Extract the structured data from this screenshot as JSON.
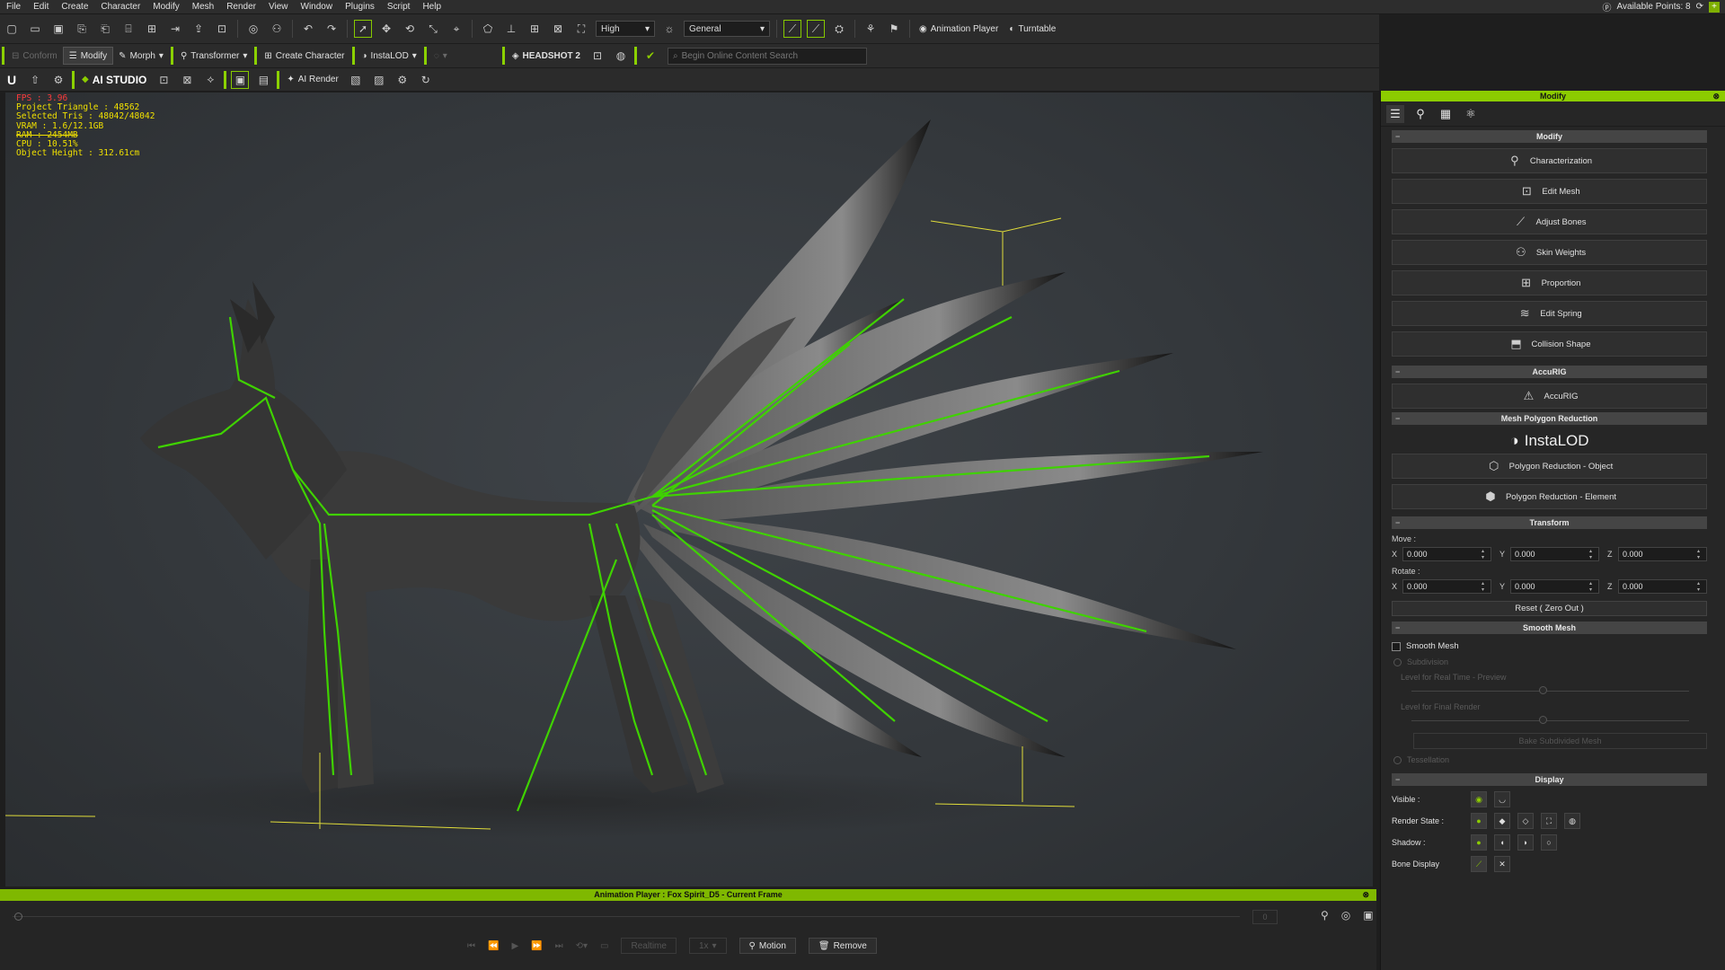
{
  "menu": [
    "File",
    "Edit",
    "Create",
    "Character",
    "Modify",
    "Mesh",
    "Render",
    "View",
    "Window",
    "Plugins",
    "Script",
    "Help"
  ],
  "menu_right": {
    "points": "Available Points: 8"
  },
  "toolbar1": {
    "quality": "High",
    "mode": "General",
    "animation_player": "Animation Player",
    "turntable": "Turntable"
  },
  "toolbar2": {
    "conform": "Conform",
    "modify": "Modify",
    "morph": "Morph",
    "transformer": "Transformer",
    "create_character": "Create Character",
    "instalod": "InstaLOD",
    "headshot": "HEADSHOT 2",
    "search_placeholder": "Begin Online Content Search"
  },
  "toolbar3": {
    "ai_studio": "AI STUDIO",
    "ai_render": "AI Render"
  },
  "stats": {
    "fps": "FPS : 3.96",
    "project_triangle": "Project Triangle : 48562",
    "selected_tris": "Selected Tris : 48042/48042",
    "vram": "VRAM : 1.6/12.1GB",
    "ram": "RAM : 2454MB",
    "cpu": "CPU : 10.51%",
    "object_height": "Object Height : 312.61cm"
  },
  "panel": {
    "title": "Modify",
    "modify_header": "Modify",
    "buttons": [
      "Characterization",
      "Edit Mesh",
      "Adjust Bones",
      "Skin Weights",
      "Proportion",
      "Edit Spring",
      "Collision Shape"
    ],
    "accurig_header": "AccuRIG",
    "accurig_btn": "AccuRIG",
    "mpr_header": "Mesh Polygon Reduction",
    "instalod_logo": "InstaLOD",
    "poly_object": "Polygon Reduction - Object",
    "poly_element": "Polygon Reduction - Element",
    "transform_header": "Transform",
    "move_label": "Move :",
    "rotate_label": "Rotate :",
    "axis_x": "X",
    "axis_y": "Y",
    "axis_z": "Z",
    "move": {
      "x": "0.000",
      "y": "0.000",
      "z": "0.000"
    },
    "rotate": {
      "x": "0.000",
      "y": "0.000",
      "z": "0.000"
    },
    "reset": "Reset ( Zero Out )",
    "smooth_header": "Smooth Mesh",
    "smooth_mesh": "Smooth Mesh",
    "subdivision": "Subdivision",
    "level_realtime": "Level for Real Time - Preview",
    "level_final": "Level for Final Render",
    "level_realtime_val": "1",
    "level_final_val": "1",
    "bake": "Bake Subdivided Mesh",
    "tessellation": "Tessellation",
    "display_header": "Display",
    "visible": "Visible :",
    "render_state": "Render State :",
    "shadow": "Shadow :",
    "bone_display": "Bone Display"
  },
  "anim": {
    "title": "Animation Player : Fox Spirit_D5 - Current Frame",
    "frame": "0",
    "realtime": "Realtime",
    "speed": "1x",
    "motion": "Motion",
    "remove": "Remove"
  }
}
